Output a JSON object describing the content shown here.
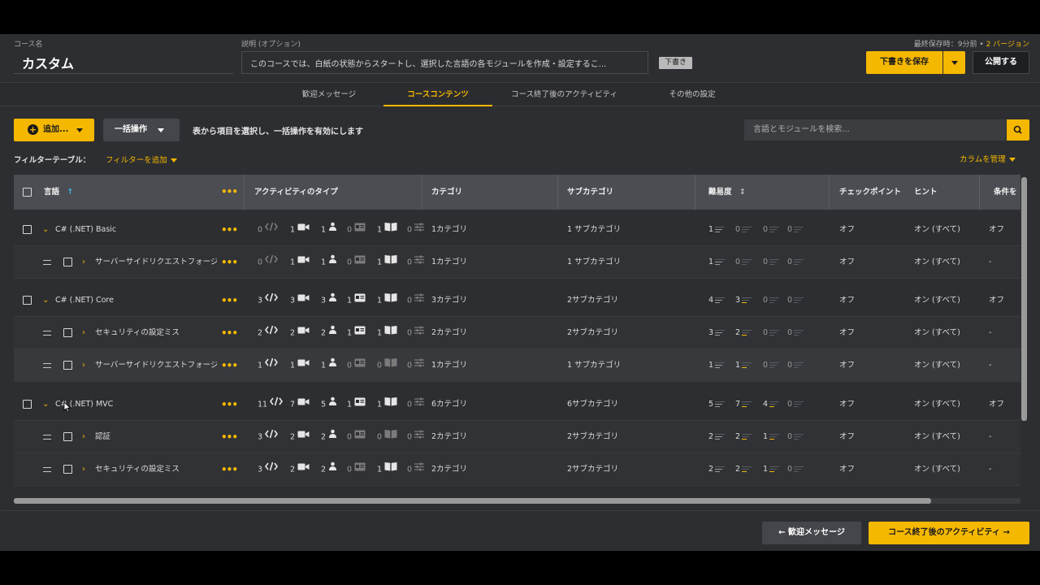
{
  "header": {
    "course_name_label": "コース名",
    "course_name": "カスタム",
    "description_label": "説明 (オプション)",
    "description_value": "このコースでは、白紙の状態からスタートし、選択した言語の各モジュールを作成・設定するこ...",
    "draft_badge": "下書き",
    "last_saved_prefix": "最終保存時：9分前 •",
    "version_link": "2 バージョン",
    "save_draft_label": "下書きを保存",
    "publish_label": "公開する"
  },
  "tabs": [
    {
      "label": "歓迎メッセージ",
      "active": false
    },
    {
      "label": "コースコンテンツ",
      "active": true
    },
    {
      "label": "コース終了後のアクティビティ",
      "active": false
    },
    {
      "label": "その他の設定",
      "active": false
    }
  ],
  "toolbar": {
    "add_label": "追加...",
    "bulk_label": "一括操作",
    "bulk_hint": "表から項目を選択し、一括操作を有効にします",
    "search_placeholder": "言語とモジュールを検索...",
    "filter_label": "フィルターテーブル：",
    "filter_add": "フィルターを追加",
    "column_manage": "カラムを管理"
  },
  "table": {
    "columns": [
      "言語",
      "アクティビティのタイプ",
      "カテゴリ",
      "サブカテゴリ",
      "難易度",
      "チェックポイント",
      "ヒント",
      "条件を"
    ],
    "rows": [
      {
        "kind": "parent",
        "name": "C# (.NET) Basic",
        "acts": [
          "0",
          "1",
          "1",
          "0",
          "1",
          "0"
        ],
        "category": "1カテゴリ",
        "subcategory": "1 サブカテゴリ",
        "diff": [
          "1",
          "0",
          "0",
          "0"
        ],
        "checkpoint": "オフ",
        "hint": "オン (すべて)",
        "cond": "オフ"
      },
      {
        "kind": "child",
        "name": "サーバーサイドリクエストフォージェリ",
        "acts": [
          "0",
          "1",
          "1",
          "0",
          "1",
          "0"
        ],
        "category": "1カテゴリ",
        "subcategory": "1 サブカテゴリ",
        "diff": [
          "1",
          "0",
          "0",
          "0"
        ],
        "checkpoint": "オフ",
        "hint": "オン (すべて)",
        "cond": "-"
      },
      {
        "kind": "parent",
        "name": "C# (.NET) Core",
        "acts": [
          "3",
          "3",
          "3",
          "1",
          "1",
          "0"
        ],
        "category": "3カテゴリ",
        "subcategory": "2サブカテゴリ",
        "diff": [
          "4",
          "3",
          "0",
          "0"
        ],
        "checkpoint": "オフ",
        "hint": "オン (すべて)",
        "cond": "オフ"
      },
      {
        "kind": "child",
        "name": "セキュリティの設定ミス",
        "acts": [
          "2",
          "2",
          "2",
          "1",
          "1",
          "0"
        ],
        "category": "2カテゴリ",
        "subcategory": "2サブカテゴリ",
        "diff": [
          "3",
          "2",
          "0",
          "0"
        ],
        "checkpoint": "オフ",
        "hint": "オン (すべて)",
        "cond": "-"
      },
      {
        "kind": "child",
        "name": "サーバーサイドリクエストフォージェリ",
        "acts": [
          "1",
          "1",
          "1",
          "0",
          "0",
          "0"
        ],
        "category": "1カテゴリ",
        "subcategory": "1 サブカテゴリ",
        "diff": [
          "1",
          "1",
          "0",
          "0"
        ],
        "checkpoint": "オフ",
        "hint": "オン (すべて)",
        "cond": "-"
      },
      {
        "kind": "parent",
        "name": "C# (.NET) MVC",
        "acts": [
          "11",
          "7",
          "5",
          "1",
          "1",
          "0"
        ],
        "category": "6カテゴリ",
        "subcategory": "6サブカテゴリ",
        "diff": [
          "5",
          "7",
          "4",
          "0"
        ],
        "checkpoint": "オフ",
        "hint": "オン (すべて)",
        "cond": "オフ"
      },
      {
        "kind": "child",
        "name": "認証",
        "acts": [
          "3",
          "2",
          "2",
          "0",
          "0",
          "0"
        ],
        "category": "2カテゴリ",
        "subcategory": "2サブカテゴリ",
        "diff": [
          "2",
          "2",
          "1",
          "0"
        ],
        "checkpoint": "オフ",
        "hint": "オン (すべて)",
        "cond": "-"
      },
      {
        "kind": "child",
        "name": "セキュリティの設定ミス",
        "acts": [
          "3",
          "2",
          "2",
          "0",
          "1",
          "0"
        ],
        "category": "2カテゴリ",
        "subcategory": "2サブカテゴリ",
        "diff": [
          "2",
          "2",
          "1",
          "0"
        ],
        "checkpoint": "オフ",
        "hint": "オン (すべて)",
        "cond": "-"
      }
    ]
  },
  "footer": {
    "prev_label": "歓迎メッセージ",
    "next_label": "コース終了後のアクティビティ"
  },
  "colors": {
    "accent": "#f5b800",
    "bg": "#2d2e31",
    "header_row": "#4c4d52"
  },
  "icons": [
    "code-icon",
    "video-icon",
    "mentor-icon",
    "id-card-icon",
    "book-icon",
    "sliders-icon",
    "search-icon",
    "plus-icon",
    "arrow-left-icon",
    "arrow-right-icon",
    "sort-asc-icon",
    "sort-icon"
  ]
}
